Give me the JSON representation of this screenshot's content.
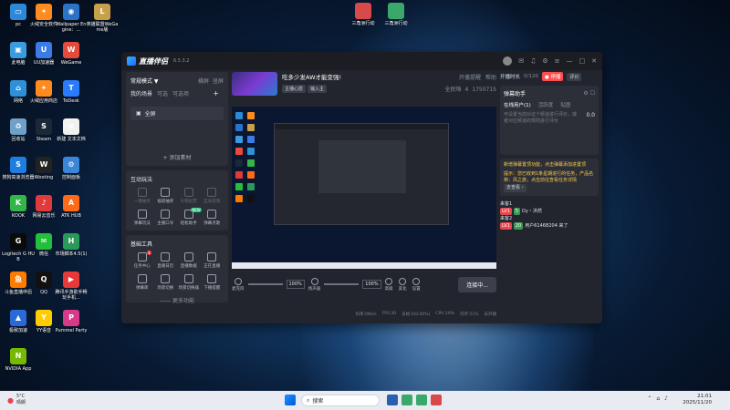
{
  "desktop_icons": [
    {
      "label": "pc",
      "color": "#2d89d8",
      "glyph": "▭"
    },
    {
      "label": "火绒安全软件",
      "color": "#ff8a1e",
      "glyph": "✦"
    },
    {
      "label": "Wallpaper Engine：...",
      "color": "#2b72c9",
      "glyph": "◉"
    },
    {
      "label": "英雄联盟WeGame版",
      "color": "#c9a04a",
      "glyph": "L"
    },
    {
      "label": "此电脑",
      "color": "#3b9bdf",
      "glyph": "▣"
    },
    {
      "label": "UU加速器",
      "color": "#3a7be8",
      "glyph": "U"
    },
    {
      "label": "WeGame",
      "color": "#e64a3a",
      "glyph": "W"
    },
    {
      "label": "网络",
      "color": "#2f90d8",
      "glyph": "⌂"
    },
    {
      "label": "火绒应用商店",
      "color": "#ff8a1e",
      "glyph": "✦"
    },
    {
      "label": "ToDesk",
      "color": "#2a7cff",
      "glyph": "T"
    },
    {
      "label": "回收站",
      "color": "#6fa0c8",
      "glyph": "♻"
    },
    {
      "label": "Steam",
      "color": "#1b2838",
      "glyph": "S"
    },
    {
      "label": "新建 文本文档",
      "color": "#f1f1f1",
      "glyph": "≡"
    },
    {
      "label": "搜狗高速浏览器",
      "color": "#1f7de0",
      "glyph": "S"
    },
    {
      "label": "Wooting",
      "color": "#222222",
      "glyph": "W"
    },
    {
      "label": "控制面板",
      "color": "#3a86d8",
      "glyph": "⚙"
    },
    {
      "label": "KOOK",
      "color": "#33b54a",
      "glyph": "K"
    },
    {
      "label": "网易云音乐",
      "color": "#e23a3a",
      "glyph": "♪"
    },
    {
      "label": "ATK HUB",
      "color": "#ff6a1a",
      "glyph": "A"
    },
    {
      "label": "Logitech G HUB",
      "color": "#0a0a0a",
      "glyph": "G"
    },
    {
      "label": "微信",
      "color": "#22c03a",
      "glyph": "✉"
    },
    {
      "label": "市场脚本4.5(1)",
      "color": "#2a9a5a",
      "glyph": "H"
    },
    {
      "label": "斗鱼直播伴侣",
      "color": "#ff7a00",
      "glyph": "鱼"
    },
    {
      "label": "QQ",
      "color": "#111111",
      "glyph": "Q"
    },
    {
      "label": "腾讯手游助手畅玩手机...",
      "color": "#e63a3a",
      "glyph": "▶"
    },
    {
      "label": "极致加速",
      "color": "#2a6ad8",
      "glyph": "▲"
    },
    {
      "label": "YY语音",
      "color": "#ffcc00",
      "glyph": "Y"
    },
    {
      "label": "Pummel Party",
      "color": "#d83a8a",
      "glyph": "P"
    },
    {
      "label": "NVIDIA App",
      "color": "#76b900",
      "glyph": "N"
    }
  ],
  "top_desktop_icons": [
    {
      "label": "三角洲行动",
      "color": "#d84a4a"
    },
    {
      "label": "三角洲行动",
      "color": "#3aa86a"
    }
  ],
  "app": {
    "name": "直播伴侣",
    "version": "6.5.3.2",
    "left": {
      "mode": "常规模式 ▼",
      "mode_actions": [
        "横屏",
        "竖屏"
      ],
      "scene_tabs": [
        "我的场景",
        "可选",
        "可选项"
      ],
      "scene_item": "全屏",
      "add_source": "+ 添加素材",
      "interact_title": "互动玩法",
      "interact_tools": [
        {
          "label": "一键抽奖",
          "dim": true
        },
        {
          "label": "福袋抽奖",
          "dim": false
        },
        {
          "label": "礼物投票",
          "dim": true
        },
        {
          "label": "互动游戏",
          "dim": true
        },
        {
          "label": "弹幕玩法",
          "dim": false
        },
        {
          "label": "主播口令",
          "dim": false
        },
        {
          "label": "轻松助手",
          "dim": false,
          "badge": "NEW"
        },
        {
          "label": "弹幕点歌",
          "dim": false
        }
      ],
      "basic_title": "基础工具",
      "basic_tools": [
        {
          "label": "任务中心",
          "badge": "1"
        },
        {
          "label": "直播日历"
        },
        {
          "label": "直播数据"
        },
        {
          "label": "正在直播"
        },
        {
          "label": "弹幕库"
        },
        {
          "label": "场景切换"
        },
        {
          "label": "场景切换器"
        },
        {
          "label": "下播提醒"
        }
      ],
      "more_label": "—— 更多功能"
    },
    "center": {
      "stream_title": "吃多少发AW才能变强!",
      "stream_chips": [
        "主播心愿",
        "输入主"
      ],
      "header_right": [
        "开播提醒",
        "帮助"
      ],
      "stats": [
        "全民嗨",
        "4",
        "1750715"
      ],
      "controls": {
        "mic_label": "麦克风",
        "mic_pct": "100%",
        "speaker_label": "扬声器",
        "speaker_pct": "100%",
        "buttons": [
          "高级",
          "美化",
          "设置"
        ],
        "connect": "连接中..."
      },
      "status": [
        "码率:0Kb/s",
        "FPS:30",
        "丢帧:0(0.00%)",
        "CPU:19%",
        "内存:51%",
        "未开播"
      ]
    },
    "right": {
      "header_label": "开播时长",
      "counter": "0/120",
      "record_btn": "● 停播",
      "rating": "评价",
      "assist_title": "弹幕助手",
      "sub_tabs": [
        "在线用户(1)",
        "活跃度",
        "贴图"
      ],
      "placeholder": "可设置当前对这个频道进行评价，或者对应频道的规则进行评价",
      "number": "0.0",
      "event_text": "新增弹幕置顶功能，点击弹幕添加进置顶",
      "event_task": "提示：您已收到1条星期进行的任务，产品名称：风之旅，点击前往查看任务详情",
      "event_link": "去查看 ›",
      "danmu": [
        {
          "user": "来客1",
          "lv1": "LV1",
          "lv2": "5",
          "text": "Dy・沐然"
        },
        {
          "user": "来客2",
          "lv1": "LV1",
          "lv2": "20",
          "text": "用户6146B204 来了"
        }
      ]
    }
  },
  "taskbar": {
    "weather_temp": "5°C",
    "weather_desc": "晴朗",
    "search": "搜索",
    "time": "21:01",
    "date": "2025/11/20"
  }
}
